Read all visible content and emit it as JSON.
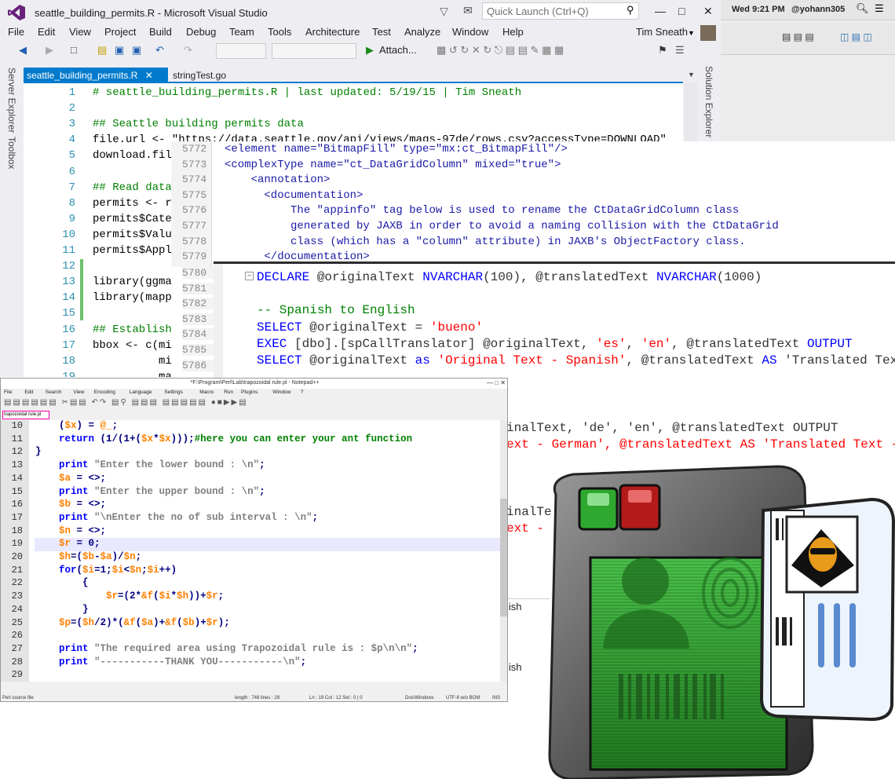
{
  "vs": {
    "title": "seattle_building_permits.R - Microsoft Visual Studio",
    "quick_launch": "Quick Launch (Ctrl+Q)",
    "user": "Tim Sneath",
    "menu": [
      "File",
      "Edit",
      "View",
      "Project",
      "Build",
      "Debug",
      "Team",
      "Tools",
      "Architecture",
      "Test",
      "Analyze",
      "Window",
      "Help"
    ],
    "attach_label": "Attach...",
    "left_panels": [
      "Server Explorer",
      "Toolbox"
    ],
    "right_panel": "Solution Explorer",
    "tab_active": "seattle_building_permits.R",
    "tab_inactive": "stringTest.go",
    "lines": [
      {
        "n": "1",
        "t": "# seattle_building_permits.R | last updated: 5/19/15 | Tim Sneath",
        "c": "#008000"
      },
      {
        "n": "2",
        "t": "",
        "c": "#000"
      },
      {
        "n": "3",
        "t": "## Seattle building permits data",
        "c": "#008000"
      },
      {
        "n": "4",
        "t": "file.url <- \"https://data.seattle.gov/api/views/mags-97de/rows.csv?accessType=DOWNLOAD\"",
        "c": "#000"
      },
      {
        "n": "5",
        "t": "download.fil",
        "c": "#000"
      },
      {
        "n": "6",
        "t": "",
        "c": "#000"
      },
      {
        "n": "7",
        "t": "## Read data",
        "c": "#008000"
      },
      {
        "n": "8",
        "t": "permits <- r",
        "c": "#000"
      },
      {
        "n": "9",
        "t": "permits$Cate",
        "c": "#000"
      },
      {
        "n": "10",
        "t": "permits$Valu",
        "c": "#000"
      },
      {
        "n": "11",
        "t": "permits$Appl",
        "c": "#000"
      },
      {
        "n": "12",
        "t": "",
        "c": "#000"
      },
      {
        "n": "13",
        "t": "library(ggma",
        "c": "#000"
      },
      {
        "n": "14",
        "t": "library(mapp",
        "c": "#000"
      },
      {
        "n": "15",
        "t": "",
        "c": "#000"
      },
      {
        "n": "16",
        "t": "## Establish",
        "c": "#008000"
      },
      {
        "n": "17",
        "t": "bbox <- c(mi",
        "c": "#000"
      },
      {
        "n": "18",
        "t": "          mi",
        "c": "#000"
      },
      {
        "n": "19",
        "t": "          ma",
        "c": "#000"
      }
    ]
  },
  "mac": {
    "clock": "Wed 9:21 PM",
    "user": "@yohann305"
  },
  "xml": {
    "lines": [
      {
        "n": "5772",
        "t": "<element name=\"BitmapFill\" type=\"mx:ct_BitmapFill\"/>"
      },
      {
        "n": "5773",
        "t": "<complexType name=\"ct_DataGridColumn\" mixed=\"true\">"
      },
      {
        "n": "5774",
        "t": "    <annotation>"
      },
      {
        "n": "5775",
        "t": "      <documentation>"
      },
      {
        "n": "5776",
        "t": "          The \"appinfo\" tag below is used to rename the CtDataGridColumn class"
      },
      {
        "n": "5777",
        "t": "          generated by JAXB in order to avoid a naming collision with the CtDataGrid"
      },
      {
        "n": "5778",
        "t": "          class (which has a \"column\" attribute) in JAXB's ObjectFactory class."
      },
      {
        "n": "5779",
        "t": "      </documentation>"
      }
    ],
    "more_numbers": [
      "5780",
      "5781",
      "5782",
      "5783",
      "5784",
      "5785",
      "5786"
    ]
  },
  "sql": {
    "lines": [
      "DECLARE @originalText NVARCHAR(100), @translatedText NVARCHAR(1000)",
      "",
      "-- Spanish to English",
      "SELECT @originalText = 'bueno'",
      "EXEC [dbo].[spCallTranslator] @originalText, 'es', 'en', @translatedText OUTPUT",
      "SELECT @originalText as 'Original Text - Spanish', @translatedText AS 'Translated Text - En"
    ],
    "frag1": "inalText, 'de', 'en', @translatedText OUTPUT",
    "frag2": "ext - German', @translatedText AS 'Translated Text - Eng",
    "frag3": "inalTe",
    "frag4": "ext -",
    "frag5": "lish",
    "frag6": "lish"
  },
  "npp": {
    "title": "*F:\\Program\\Perl\\Lab\\trapozoidal rule.pl - Notepad++",
    "menu": [
      "File",
      "Edit",
      "Search",
      "View",
      "Encoding",
      "Language",
      "Settings",
      "Macro",
      "Run",
      "Plugins",
      "Window",
      "?"
    ],
    "tab": "trapozoidal rule.pl",
    "lines": [
      {
        "n": "10",
        "t": "    ($x) = @_;"
      },
      {
        "n": "11",
        "t": "    return (1/(1+($x*$x)));#here you can enter your ant function"
      },
      {
        "n": "12",
        "t": "}"
      },
      {
        "n": "13",
        "t": "    print \"Enter the lower bound : \\n\";"
      },
      {
        "n": "14",
        "t": "    $a = <>;"
      },
      {
        "n": "15",
        "t": "    print \"Enter the upper bound : \\n\";"
      },
      {
        "n": "16",
        "t": "    $b = <>;"
      },
      {
        "n": "17",
        "t": "    print \"\\nEnter the no of sub interval : \\n\";"
      },
      {
        "n": "18",
        "t": "    $n = <>;"
      },
      {
        "n": "19",
        "t": "    $r = 0;"
      },
      {
        "n": "20",
        "t": "    $h=($b-$a)/$n;"
      },
      {
        "n": "21",
        "t": "    for($i=1;$i<$n;$i++)"
      },
      {
        "n": "22",
        "t": "        {"
      },
      {
        "n": "23",
        "t": "            $r=(2*&f($i*$h))+$r;"
      },
      {
        "n": "24",
        "t": "        }"
      },
      {
        "n": "25",
        "t": "    $p=($h/2)*(&f($a)+&f($b)+$r);"
      },
      {
        "n": "26",
        "t": ""
      },
      {
        "n": "27",
        "t": "    print \"The required area using Trapozoidal rule is : $p\\n\\n\";"
      },
      {
        "n": "28",
        "t": "    print \"-----------THANK YOU-----------\\n\";"
      },
      {
        "n": "29",
        "t": ""
      }
    ],
    "status": {
      "type": "Perl source file",
      "len": "length : 748   lines : 29",
      "pos": "Ln : 19   Col : 12   Sel : 0 | 0",
      "eol": "Dos\\Windows",
      "enc": "UTF-8 w/o BOM",
      "ins": "INS"
    }
  },
  "colors": {
    "vs_accent": "#007acc",
    "vs_purple": "#68217a",
    "green": "#008000",
    "sql_keyword": "#0000ff",
    "sql_string": "#ff0000"
  },
  "icons": [
    "visual-studio-logo-icon",
    "card-reader-icon",
    "id-card-icon",
    "fingerprint-icon"
  ]
}
